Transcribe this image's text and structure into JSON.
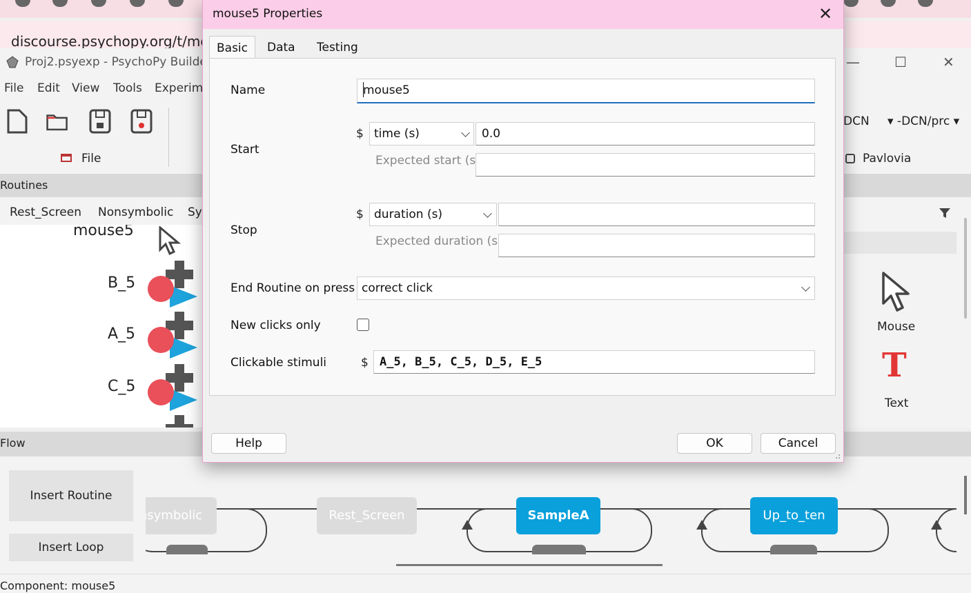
{
  "browser": {
    "url": "discourse.psychopy.org/t/mou"
  },
  "builder": {
    "title": "Proj2.psyexp - PsychoPy Builder",
    "menu": [
      "File",
      "Edit",
      "View",
      "Tools",
      "Experime"
    ],
    "toolbar": {
      "file_label": "File",
      "dcn1": "DCN",
      "dcn2": "▾  -DCN/prc  ▾",
      "pavlovia_label": "Pavlovia"
    },
    "routines_label": "Routines",
    "routine_tabs": [
      "Rest_Screen",
      "Nonsymbolic",
      "Sy"
    ],
    "components": {
      "mouse5": "mouse5",
      "b5": "B_5",
      "a5": "A_5",
      "c5": "C_5"
    },
    "panel": {
      "mouse_label": "Mouse",
      "text_icon": "T",
      "text_label": "Text"
    },
    "flow": {
      "label": "Flow",
      "insert_routine": "Insert Routine",
      "insert_loop": "Insert Loop",
      "routines": [
        {
          "label": "nsymbolic",
          "style": "gray"
        },
        {
          "label": "Rest_Screen",
          "style": "gray"
        },
        {
          "label": "SampleA",
          "style": "blue-bold"
        },
        {
          "label": "Up_to_ten",
          "style": "blue"
        }
      ]
    },
    "status": "Component: mouse5"
  },
  "dialog": {
    "title": "mouse5 Properties",
    "tabs": [
      "Basic",
      "Data",
      "Testing"
    ],
    "active_tab": "Basic",
    "fields": {
      "name_label": "Name",
      "name_value": "mouse5",
      "start_label": "Start",
      "start_dollar": "$",
      "start_type": "time (s)",
      "start_value": "0.0",
      "expected_start_label": "Expected start (s)",
      "expected_start_value": "",
      "stop_label": "Stop",
      "stop_dollar": "$",
      "stop_type": "duration (s)",
      "stop_value": "",
      "expected_duration_label": "Expected duration (s)",
      "expected_duration_value": "",
      "end_routine_label": "End Routine on press",
      "end_routine_value": "correct click",
      "new_clicks_label": "New clicks only",
      "new_clicks_checked": false,
      "clickable_label": "Clickable stimuli",
      "clickable_dollar": "$",
      "clickable_value": "A_5, B_5, C_5, D_5, E_5"
    },
    "buttons": {
      "help": "Help",
      "ok": "OK",
      "cancel": "Cancel"
    }
  },
  "colors": {
    "dialog_title_bg": "#fccde8",
    "flow_blue": "#0aa0dc",
    "flow_gray": "#dcdcdc",
    "accent_underline": "#1f6ebd",
    "red_component": "#e9505a",
    "blue_component": "#1ea3dc"
  }
}
